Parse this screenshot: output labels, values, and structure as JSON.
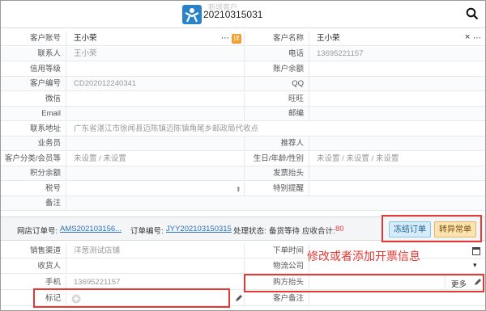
{
  "window": {
    "title": "20210315031",
    "watermark": "新增客户"
  },
  "customer": {
    "account_label": "客户账号",
    "account_value": "王小荣",
    "more_glyph": "⋯",
    "detail_badge": "详",
    "name_label": "客户名称",
    "name_value": "王小荣",
    "contact_label": "联系人",
    "contact_value": "王小荣",
    "phone_label": "电话",
    "phone_value": "13695221157",
    "credit_label": "信用等级",
    "credit_value": "",
    "balance_label": "账户余额",
    "balance_value": "",
    "code_label": "客户编号",
    "code_value": "CD202012240341",
    "qq_label": "QQ",
    "qq_value": "",
    "wechat_label": "微信",
    "wechat_value": "",
    "wangwang_label": "旺旺",
    "wangwang_value": "",
    "email_label": "Email",
    "email_value": "",
    "zip_label": "邮编",
    "zip_value": "",
    "address_label": "联系地址",
    "address_value": "广东省湛江市徐闻县迈陈镇迈陈镇角尾乡邮政局代收点",
    "salesman_label": "业务员",
    "salesman_value": "",
    "referrer_label": "推荐人",
    "referrer_value": "",
    "category_label": "客户分类/会员等级",
    "category_value": "未设置 / 未设置",
    "birthday_label": "生日/年龄/性别",
    "birthday_value": "未设置 / 未设置 / 未设置",
    "points_label": "积分余额",
    "points_value": "",
    "invoice_title_label": "发票抬头",
    "invoice_title_value": "",
    "tax_label": "税号",
    "tax_value": "",
    "remind_label": "特别提醒",
    "remind_value": "",
    "note_label": "备注",
    "note_value": ""
  },
  "order": {
    "shop_order_label": "网店订单号:",
    "shop_order_value": "AMS202103156...",
    "order_no_label": "订单编号:",
    "order_no_value": "JYY202103150315",
    "status_label": "处理状态:",
    "status_value": "备货等待",
    "receivable_label": "应收合计:",
    "receivable_value": "80",
    "freeze_button": "冻结订单",
    "abnormal_button": "转异常单"
  },
  "detail": {
    "channel_label": "销售渠道",
    "channel_value": "洋葱测试店铺",
    "order_time_label": "下单时间",
    "order_time_value": "",
    "receiver_label": "收货人",
    "receiver_value": "",
    "logistics_label": "物流公司",
    "logistics_value": "",
    "mobile_label": "手机",
    "mobile_value": "13695221157",
    "buyer_invoice_label": "购方抬头",
    "buyer_invoice_value": "",
    "more_button": "更多",
    "mark_label": "标记",
    "customer_note_label": "客户备注",
    "customer_note_value": ""
  },
  "annotation": {
    "text": "修改或者添加开票信息",
    "color": "#e53935"
  },
  "icons": [
    "app-logo-icon",
    "search-icon",
    "calendar-icon",
    "dropdown-icon",
    "pencil-icon",
    "plus-circle-icon",
    "clear-icon"
  ]
}
